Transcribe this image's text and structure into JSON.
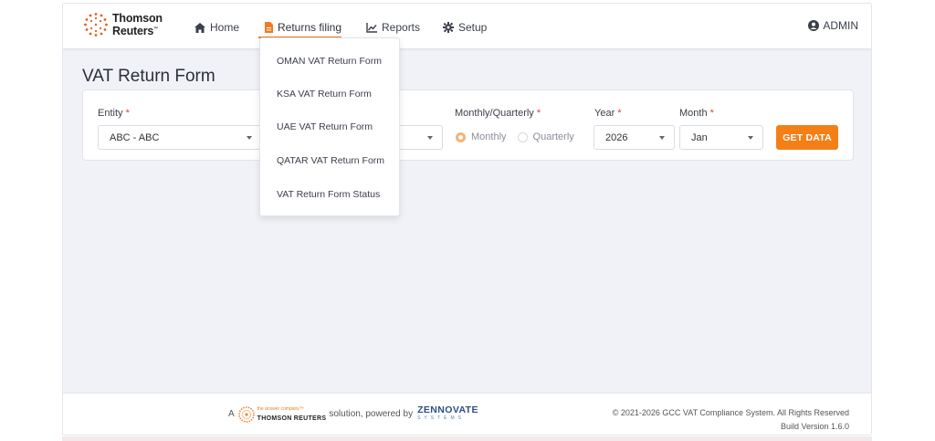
{
  "brand": {
    "line1": "Thomson",
    "line2": "Reuters",
    "tm": "™"
  },
  "nav": {
    "home": "Home",
    "returns_filing": "Returns filing",
    "reports": "Reports",
    "setup": "Setup",
    "user": "ADMIN"
  },
  "page": {
    "title": "VAT Return Form"
  },
  "form": {
    "entity_label": "Entity",
    "entity_value": "ABC - ABC",
    "period_type_label": "Monthly/Quarterly",
    "monthly_label": "Monthly",
    "quarterly_label": "Quarterly",
    "selected_period_type": "Monthly",
    "year_label": "Year",
    "year_value": "2026",
    "month_label": "Month",
    "month_value": "Jan",
    "required_mark": "*",
    "get_data_label": "GET DATA"
  },
  "returns_menu": {
    "items": [
      "OMAN VAT Return Form",
      "KSA VAT Return Form",
      "UAE VAT Return Form",
      "QATAR VAT Return Form",
      "VAT Return Form Status"
    ]
  },
  "footer": {
    "prefix": "A",
    "tr_tagline": "the answer company™",
    "tr_name": "THOMSON REUTERS",
    "middle": "solution, powered by",
    "zen_name": "ZENNOVATE",
    "zen_sub": "SYSTEMS",
    "copyright": "© 2021-2026 GCC VAT Compliance System. All Rights Reserved",
    "build": "Build Version 1.6.0"
  },
  "colors": {
    "accent": "#f57f17",
    "required": "#e0403c",
    "zennovate": "#2e4d8a"
  }
}
